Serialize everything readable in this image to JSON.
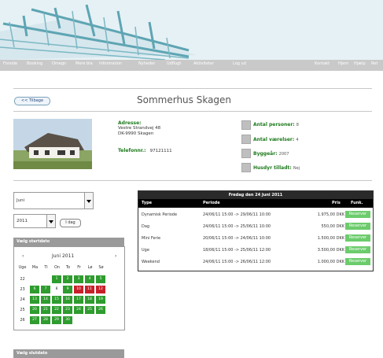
{
  "nav": {
    "items": [
      "Forside",
      "Booking",
      "Omegn",
      "Mere bla",
      "Information",
      "Nyheder",
      "Udflugt",
      "Aktiviteter",
      "Log ud"
    ],
    "right_items": [
      "Kontakt",
      "Hjem",
      "Hjælp",
      "Ret"
    ]
  },
  "back_button": "<< Tilbage",
  "title": "Sommerhus Skagen",
  "details": {
    "address_label": "Adresse:",
    "address_line1": "Vestre Strandvej 48",
    "address_line2": "DK-9990 Skagen",
    "phone_label": "Telefonnr.:",
    "phone_value": "97121111"
  },
  "features": [
    {
      "label": "Antal personer:",
      "value": "8",
      "icon": "people-icon"
    },
    {
      "label": "Antal værelser:",
      "value": "4",
      "icon": "bed-icon"
    },
    {
      "label": "Byggeår:",
      "value": "2007",
      "icon": "calendar-icon"
    },
    {
      "label": "Husdyr tilladt:",
      "value": "Nej",
      "icon": "pet-icon"
    }
  ],
  "month_select": {
    "value": "Juni"
  },
  "year_select": {
    "value": "2011"
  },
  "today_button": "I dag",
  "calendar": {
    "header": "Vælg startdato",
    "prev": "‹",
    "next": "›",
    "month_label": "Juni 2011",
    "weekdays": [
      "Uge",
      "Ma",
      "Ti",
      "On",
      "To",
      "Fr",
      "Lø",
      "Sø"
    ],
    "weeks": [
      {
        "week": "22",
        "days": [
          "",
          "",
          "1",
          "2",
          "3",
          "4",
          "5"
        ],
        "status": [
          "",
          "",
          "g",
          "g",
          "g",
          "g",
          "g"
        ]
      },
      {
        "week": "23",
        "days": [
          "6",
          "7",
          "8",
          "9",
          "10",
          "11",
          "12"
        ],
        "status": [
          "g",
          "g",
          "w",
          "g",
          "r",
          "r",
          "r"
        ]
      },
      {
        "week": "24",
        "days": [
          "13",
          "14",
          "15",
          "16",
          "17",
          "18",
          "19"
        ],
        "status": [
          "g",
          "g",
          "g",
          "g",
          "g",
          "g",
          "g"
        ]
      },
      {
        "week": "25",
        "days": [
          "20",
          "21",
          "22",
          "23",
          "24",
          "25",
          "26"
        ],
        "status": [
          "g",
          "g",
          "g",
          "g",
          "g",
          "g",
          "g"
        ]
      },
      {
        "week": "26",
        "days": [
          "27",
          "28",
          "29",
          "30",
          "",
          "",
          ""
        ],
        "status": [
          "g",
          "g",
          "g",
          "g",
          "",
          "",
          ""
        ]
      }
    ]
  },
  "calendar2": {
    "header": "Vælg slutdato"
  },
  "booking": {
    "header": "Fredag den 24 Juni 2011",
    "columns": [
      "Type",
      "Periode",
      "Pris",
      "Funk."
    ],
    "rows": [
      {
        "type": "Dynamisk Periode",
        "period": "24/06/11 15:00 -> 29/06/11 10:00",
        "price": "1.975,00 DKK",
        "action": "Reserver"
      },
      {
        "type": "Dag",
        "period": "24/06/11 15:00 -> 25/06/11 10:00",
        "price": "550,00 DKK",
        "action": "Reserver"
      },
      {
        "type": "Mini Ferie",
        "period": "20/06/11 15:00 -> 24/06/11 10:00",
        "price": "1.500,00 DKK",
        "action": "Reserver"
      },
      {
        "type": "Uge",
        "period": "18/06/11 15:00 -> 25/06/11 12:00",
        "price": "3.500,00 DKK",
        "action": "Reserver"
      },
      {
        "type": "Weekend",
        "period": "24/06/11 15:00 -> 26/06/11 12:00",
        "price": "1.000,00 DKK",
        "action": "Reserver"
      }
    ]
  },
  "colors": {
    "green": "#2e9c2e",
    "red": "#c8202a",
    "button_green": "#6ccc6c"
  }
}
